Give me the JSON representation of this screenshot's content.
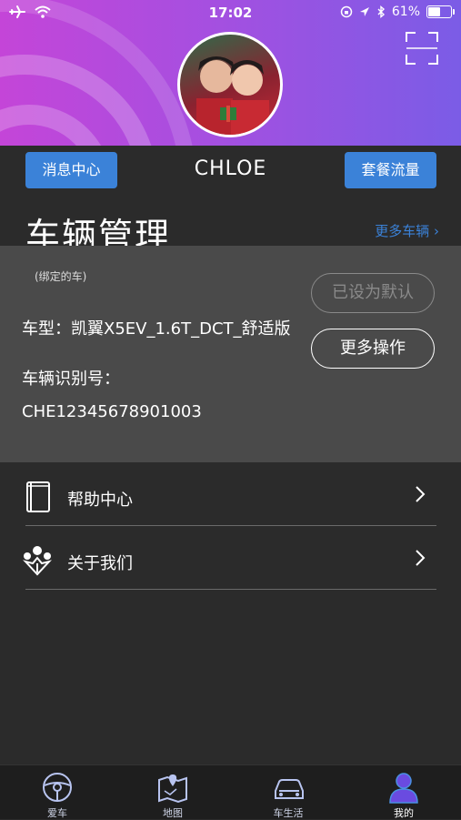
{
  "status_bar": {
    "time": "17:02",
    "battery": "61%",
    "battery_level": 0.61
  },
  "profile": {
    "username": "CHLOE"
  },
  "top_buttons": {
    "messages": "消息中心",
    "plan_data": "套餐流量"
  },
  "vehicles": {
    "title": "车辆管理",
    "more_link": "更多车辆 ›",
    "bound_note": "(绑定的车)",
    "car_type": "车型：凯翼X5EV_1.6T_DCT_舒适版",
    "vin_label": "车辆识别号：",
    "vin": "CHE12345678901003",
    "set_default_button": "已设为默认",
    "more_actions_button": "更多操作"
  },
  "menu": [
    {
      "label": "帮助中心",
      "icon": "book-icon"
    },
    {
      "label": "关于我们",
      "icon": "team-icon"
    }
  ],
  "tabs": [
    {
      "label": "爱车",
      "icon": "steering-wheel-icon",
      "active": false
    },
    {
      "label": "地图",
      "icon": "map-icon",
      "active": false
    },
    {
      "label": "车生活",
      "icon": "car-icon",
      "active": false
    },
    {
      "label": "我的",
      "icon": "person-icon",
      "active": true
    }
  ],
  "colors": {
    "accent": "#3b82d8",
    "header_start": "#c445d8",
    "header_end": "#7b5ce6",
    "background": "#2b2b2b",
    "card": "#4a4a4a"
  }
}
